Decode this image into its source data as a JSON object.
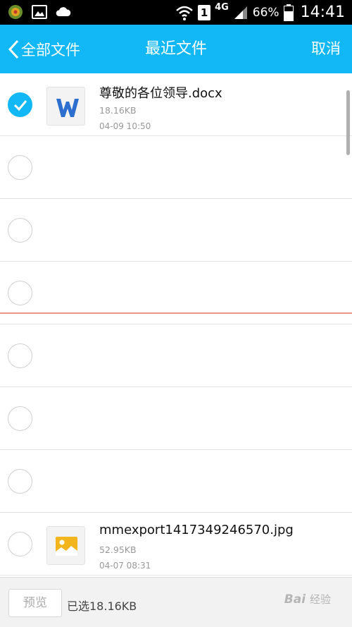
{
  "status_bar": {
    "network": "4G",
    "sim_slot": "1",
    "battery": "66%",
    "time": "14:41"
  },
  "header": {
    "back_label": "全部文件",
    "title": "最近文件",
    "cancel_label": "取消",
    "accent": "#12b7f5"
  },
  "files": [
    {
      "name": "尊敬的各位领导.docx",
      "size": "18.16KB",
      "date": "04-09 10:50",
      "selected": true,
      "icon": "word-doc-icon"
    },
    {
      "name": "",
      "size": "",
      "date": "",
      "selected": false
    },
    {
      "name": "",
      "size": "",
      "date": "",
      "selected": false
    },
    {
      "name": "",
      "size": "",
      "date": "",
      "selected": false
    },
    {
      "name": "",
      "size": "",
      "date": "",
      "selected": false
    },
    {
      "name": "",
      "size": "",
      "date": "",
      "selected": false
    },
    {
      "name": "",
      "size": "",
      "date": "",
      "selected": false
    },
    {
      "name": "mmexport1417349246570.jpg",
      "size": "52.95KB",
      "date": "04-07 08:31",
      "selected": false,
      "icon": "image-file-icon"
    }
  ],
  "bottom_bar": {
    "preview_label": "预览",
    "selected_info": "已选18.16KB"
  },
  "watermark": {
    "latin": "Bai",
    "cn": "经验"
  }
}
